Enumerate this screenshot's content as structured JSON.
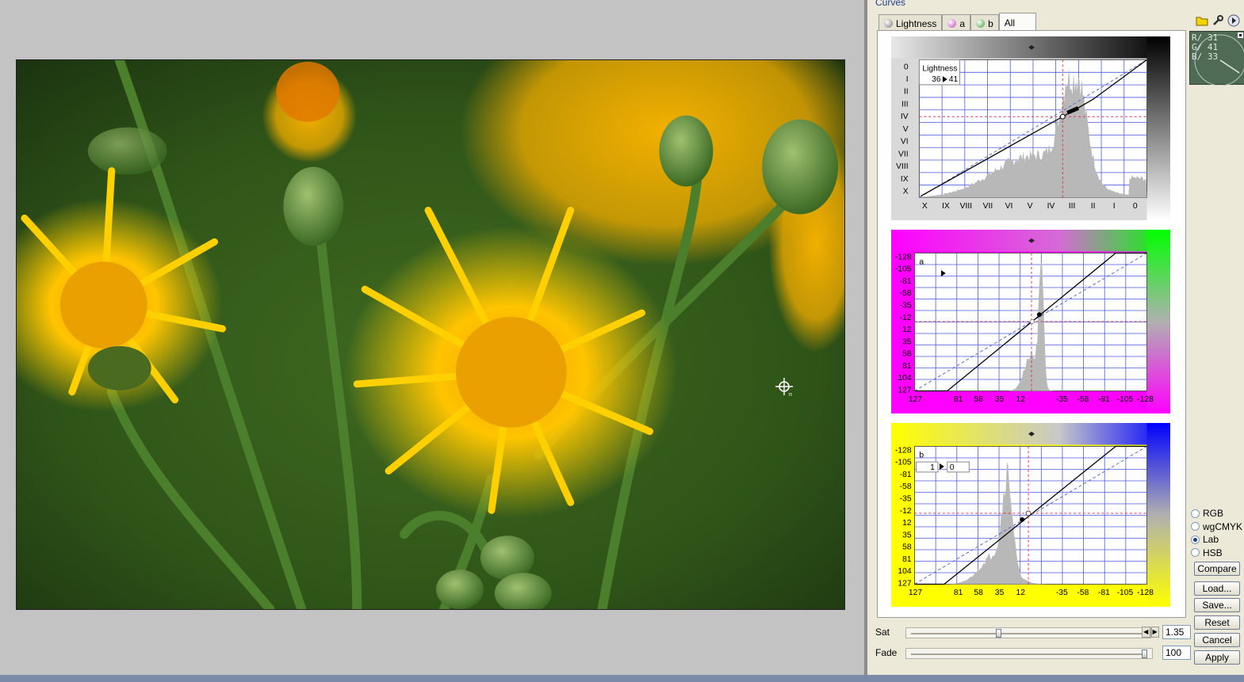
{
  "panel": {
    "title": "Curves"
  },
  "tabs": [
    {
      "label": "Lightness",
      "active": false
    },
    {
      "label": "a",
      "active": false
    },
    {
      "label": "b",
      "active": false
    },
    {
      "label": "All",
      "active": true
    }
  ],
  "icons": [
    "folder-icon",
    "wrench-icon",
    "arrow-icon"
  ],
  "meter": {
    "r_label": "R/",
    "r": "31",
    "g_label": "G/",
    "g": "41",
    "b_label": "B/",
    "b": "33"
  },
  "lightness": {
    "label": "Lightness",
    "input": "36",
    "output": "41",
    "y_ticks": [
      "0",
      "I",
      "II",
      "III",
      "IV",
      "V",
      "VI",
      "VII",
      "VIII",
      "IX",
      "X"
    ],
    "x_ticks": [
      "X",
      "IX",
      "VIII",
      "VII",
      "VI",
      "V",
      "IV",
      "III",
      "II",
      "I",
      "0"
    ]
  },
  "a_channel": {
    "label": "a",
    "y_ticks": [
      "-128",
      "-105",
      "-81",
      "-58",
      "-35",
      "-12",
      "12",
      "35",
      "58",
      "81",
      "104",
      "127"
    ],
    "x_ticks": [
      "127",
      "81",
      "58",
      "35",
      "12",
      "-35",
      "-58",
      "-81",
      "-105",
      "-128"
    ]
  },
  "b_channel": {
    "label": "b",
    "input": "1",
    "output": "0",
    "y_ticks": [
      "-128",
      "-105",
      "-81",
      "-58",
      "-35",
      "-12",
      "12",
      "35",
      "58",
      "81",
      "104",
      "127"
    ],
    "x_ticks": [
      "127",
      "81",
      "58",
      "35",
      "12",
      "-35",
      "-58",
      "-81",
      "-105",
      "-128"
    ]
  },
  "modes": [
    {
      "label": "RGB",
      "selected": false
    },
    {
      "label": "wgCMYK",
      "selected": false
    },
    {
      "label": "Lab",
      "selected": true
    },
    {
      "label": "HSB",
      "selected": false
    }
  ],
  "buttons": {
    "compare": "Compare",
    "load": "Load...",
    "save": "Save...",
    "reset": "Reset",
    "cancel": "Cancel",
    "apply": "Apply"
  },
  "sliders": {
    "sat_label": "Sat",
    "sat_value": "1.35",
    "sat_level": 0.37,
    "fade_label": "Fade",
    "fade_value": "100",
    "fade_level": 1.0
  },
  "colors": {
    "lightness_bg": "#2a2a2a",
    "a_minus": "#ff00ff",
    "a_plus": "#00ff00",
    "b_minus": "#ffff00",
    "b_plus": "#0000ff",
    "grid": "#4a5adc",
    "histogram": "#b8b8b8"
  }
}
